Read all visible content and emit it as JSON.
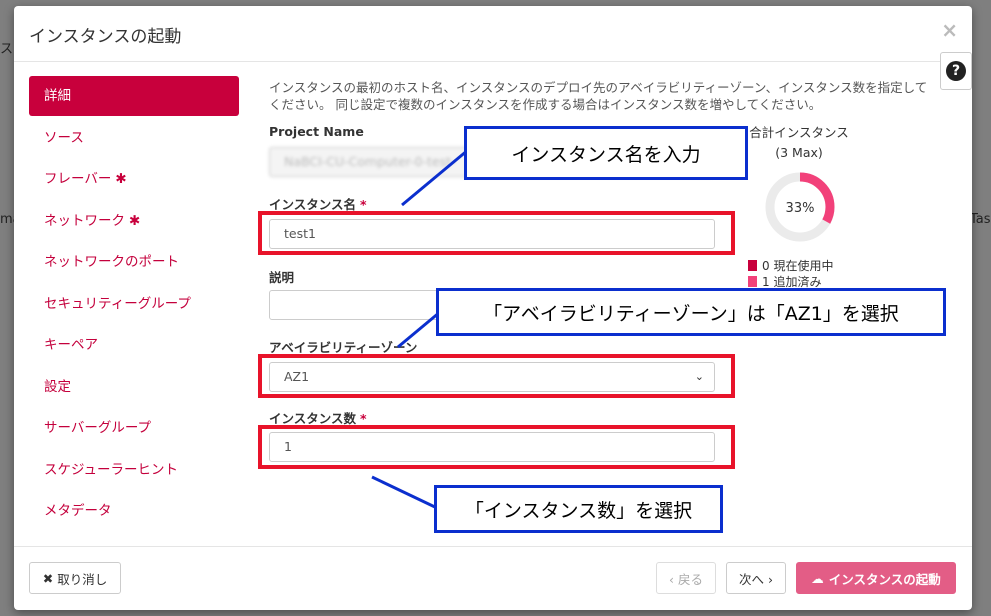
{
  "background": {
    "left_fragment": "ス",
    "mid_fragment": "ma",
    "right_fragment": "Tas"
  },
  "modal": {
    "title": "インスタンスの起動",
    "close": "×",
    "help": "?"
  },
  "nav": {
    "items": [
      {
        "label": "詳細",
        "required": false,
        "active": true
      },
      {
        "label": "ソース",
        "required": false
      },
      {
        "label": "フレーバー",
        "required": true
      },
      {
        "label": "ネットワーク",
        "required": true
      },
      {
        "label": "ネットワークのポート",
        "required": false
      },
      {
        "label": "セキュリティーグループ",
        "required": false
      },
      {
        "label": "キーペア",
        "required": false
      },
      {
        "label": "設定",
        "required": false
      },
      {
        "label": "サーバーグループ",
        "required": false
      },
      {
        "label": "スケジューラーヒント",
        "required": false
      },
      {
        "label": "メタデータ",
        "required": false
      }
    ],
    "required_mark": "✱"
  },
  "form": {
    "description": "インスタンスの最初のホスト名、インスタンスのデプロイ先のアベイラビリティーゾーン、インスタンス数を指定してください。 同じ設定で複数のインスタンスを作成する場合はインスタンス数を増やしてください。",
    "project_name_label": "Project Name",
    "project_name_value": "NaBCI-CU-Computer-0-test-",
    "instance_name_label": "インスタンス名",
    "instance_name_value": "test1",
    "description_label": "説明",
    "description_value": "",
    "availability_zone_label": "アベイラビリティーゾーン",
    "availability_zone_value": "AZ1",
    "count_label": "インスタンス数",
    "count_value": "1",
    "required_mark": "*"
  },
  "limits": {
    "title": "合計インスタンス",
    "max": "(3 Max)",
    "percent_label": "33%",
    "percent": 33,
    "legend": [
      {
        "color": "#c8003c",
        "text": "0 現在使用中"
      },
      {
        "color": "#f2417a",
        "text": "1 追加済み"
      }
    ]
  },
  "annotations": {
    "instance_name": "インスタンス名を入力",
    "availability_zone": "「アベイラビリティーゾーン」は「AZ1」を選択",
    "count": "「インスタンス数」を選択"
  },
  "footer": {
    "cancel": "取り消し",
    "back": "‹ 戻る",
    "next": "次へ ›",
    "launch": "インスタンスの起動"
  }
}
